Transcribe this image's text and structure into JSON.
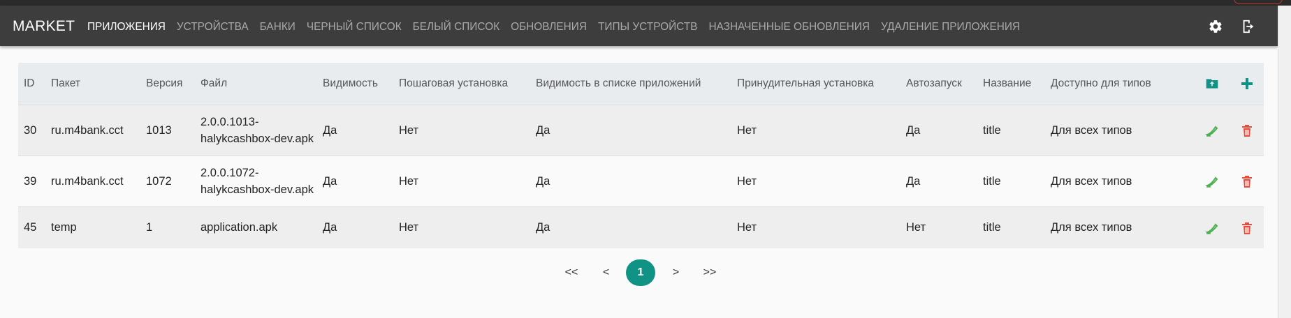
{
  "navbar": {
    "brand": "MARKET",
    "items": [
      {
        "label": "ПРИЛОЖЕНИЯ",
        "active": true
      },
      {
        "label": "УСТРОЙСТВА"
      },
      {
        "label": "БАНКИ"
      },
      {
        "label": "ЧЕРНЫЙ СПИСОК"
      },
      {
        "label": "БЕЛЫЙ СПИСОК"
      },
      {
        "label": "ОБНОВЛЕНИЯ"
      },
      {
        "label": "ТИПЫ УСТРОЙСТВ"
      },
      {
        "label": "НАЗНАЧЕННЫЕ ОБНОВЛЕНИЯ"
      },
      {
        "label": "УДАЛЕНИЕ ПРИЛОЖЕНИЯ"
      }
    ],
    "icons": [
      "gear-icon",
      "logout-icon"
    ]
  },
  "table": {
    "headers": [
      "ID",
      "Пакет",
      "Версия",
      "Файл",
      "Видимость",
      "Пошаговая установка",
      "Видимость в списке приложений",
      "Принудительная установка",
      "Автозапуск",
      "Название",
      "Доступно для типов"
    ],
    "header_icons": [
      "folder-upload-icon",
      "plus-icon"
    ],
    "rows": [
      {
        "id": "30",
        "package": "ru.m4bank.cct",
        "version": "1013",
        "file_line1": "2.0.0.1013-",
        "file_line2": "halykcashbox-dev.apk",
        "visibility": "Да",
        "stepwise": "Нет",
        "list_visibility": "Да",
        "forced": "Нет",
        "autostart": "Да",
        "name": "title",
        "types": "Для всех типов"
      },
      {
        "id": "39",
        "package": "ru.m4bank.cct",
        "version": "1072",
        "file_line1": "2.0.0.1072-",
        "file_line2": "halykcashbox-dev.apk",
        "visibility": "Да",
        "stepwise": "Нет",
        "list_visibility": "Да",
        "forced": "Нет",
        "autostart": "Да",
        "name": "title",
        "types": "Для всех типов"
      },
      {
        "id": "45",
        "package": "temp",
        "version": "1",
        "file_line1": "application.apk",
        "file_line2": "",
        "visibility": "Да",
        "stepwise": "Нет",
        "list_visibility": "Да",
        "forced": "Нет",
        "autostart": "Нет",
        "name": "title",
        "types": "Для всех типов"
      }
    ],
    "row_icons": [
      "edit-icon",
      "delete-icon"
    ]
  },
  "pagination": {
    "first": "<<",
    "prev": "<",
    "current": "1",
    "next": ">",
    "last": ">>"
  },
  "colors": {
    "navbar": "#3d3d3d",
    "accent": "#109385",
    "edit": "#4caf50",
    "delete": "#e74c3c"
  }
}
